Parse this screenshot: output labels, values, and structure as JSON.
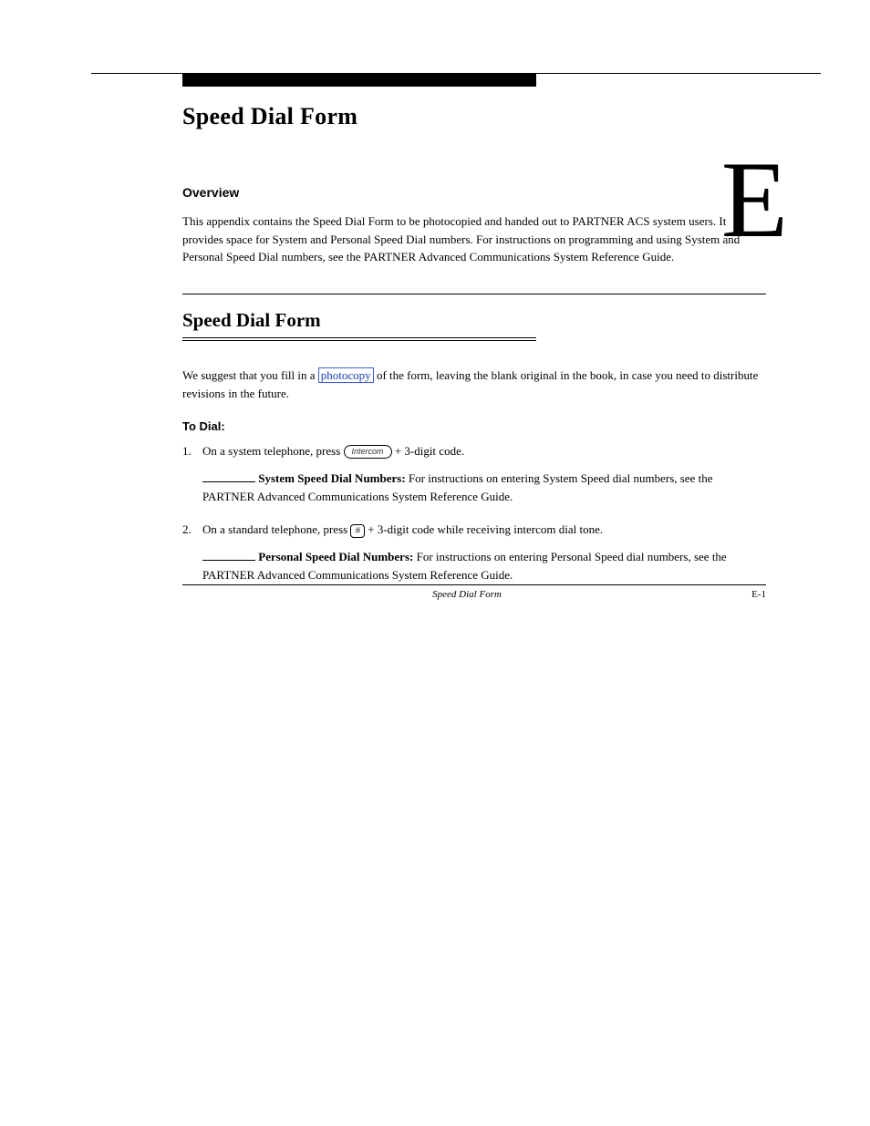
{
  "chapter": {
    "title": "Speed Dial Form",
    "label": "E"
  },
  "overview": {
    "heading": "Overview",
    "text": "This appendix contains the Speed Dial Form to be photocopied and handed out to PARTNER ACS system users. It provides space for System and Personal Speed Dial numbers. For instructions on programming and using System and Personal Speed Dial numbers, see the PARTNER Advanced Communications System Reference Guide."
  },
  "section": {
    "title": "Speed Dial Form",
    "para1_a": "We suggest that you fill in a ",
    "para1_link": "photocopy",
    "para1_b": " of the form, leaving the blank original in the book, in case you need to distribute revisions in the future.",
    "subhead": "To Dial:",
    "list": {
      "item1_a": "On a system telephone, press ",
      "item1_b": " + 3-digit code.",
      "item2_a": "On a standard telephone, press ",
      "item2_b": " + 3-digit code while receiving intercom dial tone.",
      "sub1_label": "System Speed Dial Numbers:",
      "sub1_text": " For instructions on entering System Speed dial numbers, see the PARTNER Advanced Communications System Reference Guide.",
      "sub2_label": "Personal Speed Dial Numbers:",
      "sub2_text": " For instructions on entering Personal Speed dial numbers, see the PARTNER Advanced Communications System Reference Guide."
    }
  },
  "keys": {
    "intercom": "Intercom",
    "hash": "#"
  },
  "footer": {
    "center": "Speed Dial Form",
    "right": "E-1"
  }
}
